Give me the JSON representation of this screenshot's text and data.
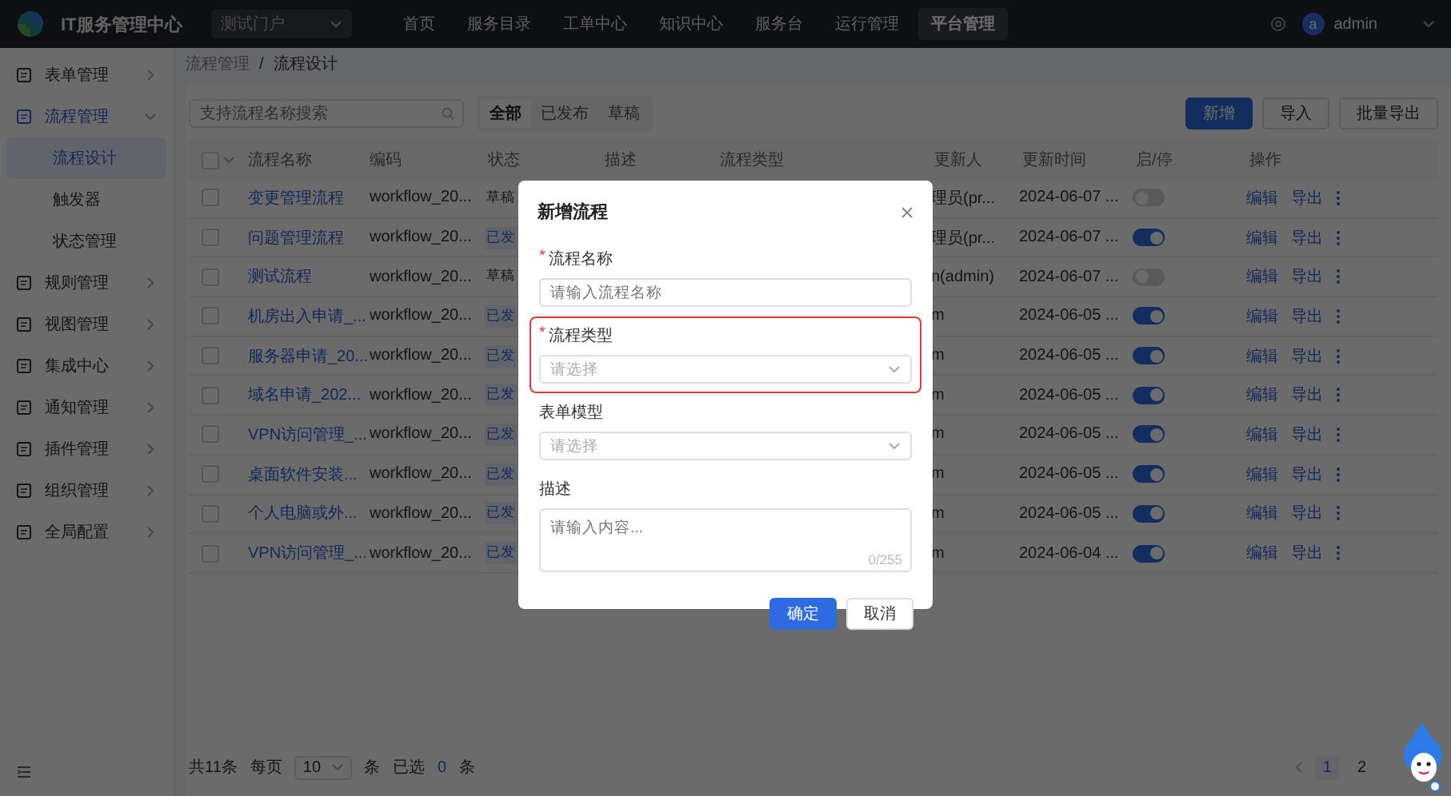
{
  "topbar": {
    "title": "IT服务管理中心",
    "portal": "测试门户",
    "nav": [
      {
        "label": "首页",
        "selected": false
      },
      {
        "label": "服务目录",
        "selected": false
      },
      {
        "label": "工单中心",
        "selected": false
      },
      {
        "label": "知识中心",
        "selected": false
      },
      {
        "label": "服务台",
        "selected": false
      },
      {
        "label": "运行管理",
        "selected": false
      },
      {
        "label": "平台管理",
        "selected": true
      }
    ],
    "avatar": "a",
    "user": "admin"
  },
  "sidebar": {
    "items": [
      {
        "label": "表单管理",
        "expanded": false
      },
      {
        "label": "流程管理",
        "expanded": true,
        "children": [
          {
            "label": "流程设计",
            "selected": true
          },
          {
            "label": "触发器",
            "selected": false
          },
          {
            "label": "状态管理",
            "selected": false
          }
        ]
      },
      {
        "label": "规则管理",
        "expanded": false
      },
      {
        "label": "视图管理",
        "expanded": false
      },
      {
        "label": "集成中心",
        "expanded": false
      },
      {
        "label": "通知管理",
        "expanded": false
      },
      {
        "label": "插件管理",
        "expanded": false
      },
      {
        "label": "组织管理",
        "expanded": false
      },
      {
        "label": "全局配置",
        "expanded": false
      }
    ]
  },
  "breadcrumb": [
    "流程管理",
    "/",
    "流程设计"
  ],
  "toolbar": {
    "search_placeholder": "支持流程名称搜索",
    "filters": [
      {
        "label": "全部",
        "selected": true
      },
      {
        "label": "已发布",
        "selected": false
      },
      {
        "label": "草稿",
        "selected": false
      }
    ],
    "buttons": [
      {
        "label": "新增",
        "kind": "primary"
      },
      {
        "label": "导入",
        "kind": "default"
      },
      {
        "label": "批量导出",
        "kind": "default"
      }
    ]
  },
  "table": {
    "all_checked": false,
    "columns": [
      "流程名称",
      "编码",
      "状态",
      "描述",
      "流程类型",
      "更新人",
      "更新时间",
      "启/停",
      "操作"
    ],
    "rows": [
      {
        "checked": false,
        "name": "变更管理流程",
        "code": "workflow_20...",
        "status": {
          "label": "草稿",
          "kind": "draft"
        },
        "updater": "理员(pr...",
        "time": "2024-06-07 ...",
        "enabled": false,
        "actions": [
          "编辑",
          "导出"
        ]
      },
      {
        "checked": false,
        "name": "问题管理流程",
        "code": "workflow_20...",
        "status": {
          "label": "已发",
          "kind": "published"
        },
        "updater": "理员(pr...",
        "time": "2024-06-07 ...",
        "enabled": true,
        "actions": [
          "编辑",
          "导出"
        ]
      },
      {
        "checked": false,
        "name": "测试流程",
        "code": "workflow_20...",
        "status": {
          "label": "草稿",
          "kind": "draft"
        },
        "updater": "n(admin)",
        "time": "2024-06-07 ...",
        "enabled": false,
        "actions": [
          "编辑",
          "导出"
        ]
      },
      {
        "checked": false,
        "name": "机房出入申请_...",
        "code": "workflow_20...",
        "status": {
          "label": "已发",
          "kind": "published"
        },
        "updater": "m",
        "time": "2024-06-05 ...",
        "enabled": true,
        "actions": [
          "编辑",
          "导出"
        ]
      },
      {
        "checked": false,
        "name": "服务器申请_20...",
        "code": "workflow_20...",
        "status": {
          "label": "已发",
          "kind": "published"
        },
        "updater": "m",
        "time": "2024-06-05 ...",
        "enabled": true,
        "actions": [
          "编辑",
          "导出"
        ]
      },
      {
        "checked": false,
        "name": "域名申请_202...",
        "code": "workflow_20...",
        "status": {
          "label": "已发",
          "kind": "published"
        },
        "updater": "m",
        "time": "2024-06-05 ...",
        "enabled": true,
        "actions": [
          "编辑",
          "导出"
        ]
      },
      {
        "checked": false,
        "name": "VPN访问管理_...",
        "code": "workflow_20...",
        "status": {
          "label": "已发",
          "kind": "published"
        },
        "updater": "m",
        "time": "2024-06-05 ...",
        "enabled": true,
        "actions": [
          "编辑",
          "导出"
        ]
      },
      {
        "checked": false,
        "name": "桌面软件安装...",
        "code": "workflow_20...",
        "status": {
          "label": "已发",
          "kind": "published"
        },
        "updater": "m",
        "time": "2024-06-05 ...",
        "enabled": true,
        "actions": [
          "编辑",
          "导出"
        ]
      },
      {
        "checked": false,
        "name": "个人电脑或外...",
        "code": "workflow_20...",
        "status": {
          "label": "已发",
          "kind": "published"
        },
        "updater": "m",
        "time": "2024-06-05 ...",
        "enabled": true,
        "actions": [
          "编辑",
          "导出"
        ]
      },
      {
        "checked": false,
        "name": "VPN访问管理_...",
        "code": "workflow_20...",
        "status": {
          "label": "已发",
          "kind": "published"
        },
        "updater": "m",
        "time": "2024-06-04 ...",
        "enabled": true,
        "actions": [
          "编辑",
          "导出"
        ]
      }
    ]
  },
  "footer": {
    "total": "共11条",
    "per_page_label": "每页",
    "per_page": "10",
    "unit": "条",
    "selected_label": "已选",
    "selected_count": "0",
    "selected_unit": "条",
    "pages": [
      {
        "label": "1",
        "selected": true
      },
      {
        "label": "2",
        "selected": false
      }
    ]
  },
  "dialog": {
    "title": "新增流程",
    "required_mark": "*",
    "fields": [
      {
        "kind": "input",
        "label": "流程名称",
        "required": true,
        "highlighted": false,
        "placeholder": "请输入流程名称"
      },
      {
        "kind": "select",
        "label": "流程类型",
        "required": true,
        "highlighted": true,
        "placeholder": "请选择"
      },
      {
        "kind": "select",
        "label": "表单模型",
        "required": false,
        "highlighted": false,
        "placeholder": "请选择"
      },
      {
        "kind": "textarea",
        "label": "描述",
        "required": false,
        "highlighted": false,
        "placeholder": "请输入内容...",
        "counter": "0/255"
      }
    ],
    "buttons": [
      {
        "label": "确定",
        "kind": "primary"
      },
      {
        "label": "取消",
        "kind": "default"
      }
    ]
  }
}
